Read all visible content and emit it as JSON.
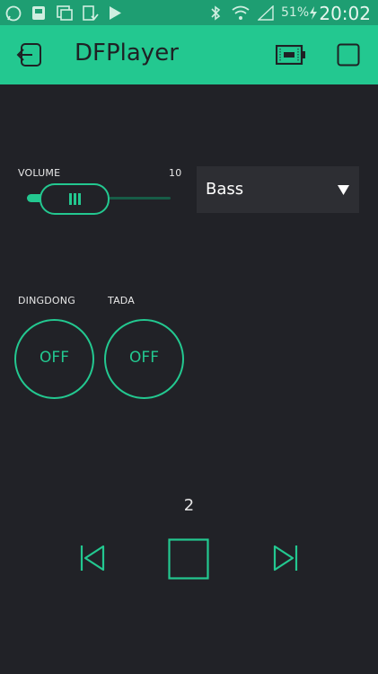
{
  "status_bar": {
    "icons": [
      "whatsapp-icon",
      "notification-icon",
      "gallery-icon",
      "task-icon",
      "play-store-icon",
      "bluetooth-icon",
      "wifi-icon",
      "signal-icon",
      "charging-icon"
    ],
    "battery": "51%",
    "time": "20:02"
  },
  "app_bar": {
    "title": "DFPlayer",
    "exit_icon": "exit-icon",
    "battery_icon": "battery-icon",
    "stop_icon": "stop-square-icon"
  },
  "volume": {
    "label": "VOLUME",
    "value": "10",
    "level_fraction": 0.33
  },
  "equalizer": {
    "selected": "Bass"
  },
  "buttons": [
    {
      "label": "DINGDONG",
      "state": "OFF"
    },
    {
      "label": "TADA",
      "state": "OFF"
    }
  ],
  "player": {
    "track_number": "2",
    "prev_icon": "previous-track-icon",
    "stop_icon": "stop-icon",
    "next_icon": "next-track-icon"
  },
  "colors": {
    "accent": "#23c890",
    "status_bar": "#1e9e72",
    "background": "#212227",
    "panel": "#2d2e33"
  }
}
